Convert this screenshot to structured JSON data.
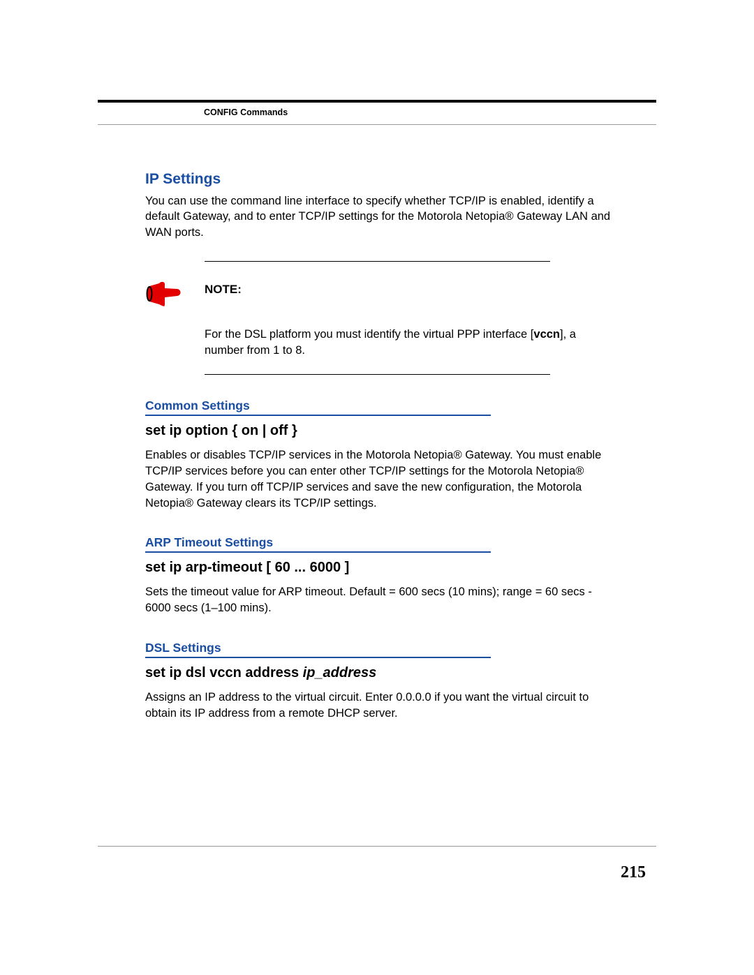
{
  "header": {
    "section": "CONFIG Commands"
  },
  "ip_settings": {
    "heading": "IP Settings",
    "intro": "You can use the command line interface to specify whether TCP/IP is enabled, identify a default Gateway, and to enter TCP/IP settings for the Motorola Netopia® Gateway LAN and WAN ports."
  },
  "note": {
    "label": "NOTE:",
    "text_pre": "For the DSL platform you must identify the virtual PPP interface [",
    "vccn": "vccn",
    "text_post": "], a number from 1 to 8."
  },
  "sections": {
    "common": {
      "heading": "Common Settings",
      "cmd": "set ip option { on | off }",
      "desc": "Enables or disables TCP/IP services in the Motorola Netopia® Gateway. You must enable TCP/IP services before you can enter other TCP/IP settings for the Motorola Netopia® Gateway. If you turn off TCP/IP services and save the new configuration, the Motorola Netopia® Gateway clears its TCP/IP settings."
    },
    "arp": {
      "heading": "ARP Timeout Settings",
      "cmd": "set ip arp-timeout [ 60 ... 6000 ]",
      "desc": "Sets the timeout value for ARP timeout. Default = 600 secs (10 mins); range = 60 secs - 6000 secs (1–100 mins)."
    },
    "dsl": {
      "heading": "DSL Settings",
      "cmd_prefix": "set ip dsl vccn address ",
      "cmd_ital": "ip_address",
      "desc": "Assigns an IP address to the virtual circuit. Enter 0.0.0.0 if you want the virtual circuit to obtain its IP address from a remote DHCP server."
    }
  },
  "page_number": "215"
}
